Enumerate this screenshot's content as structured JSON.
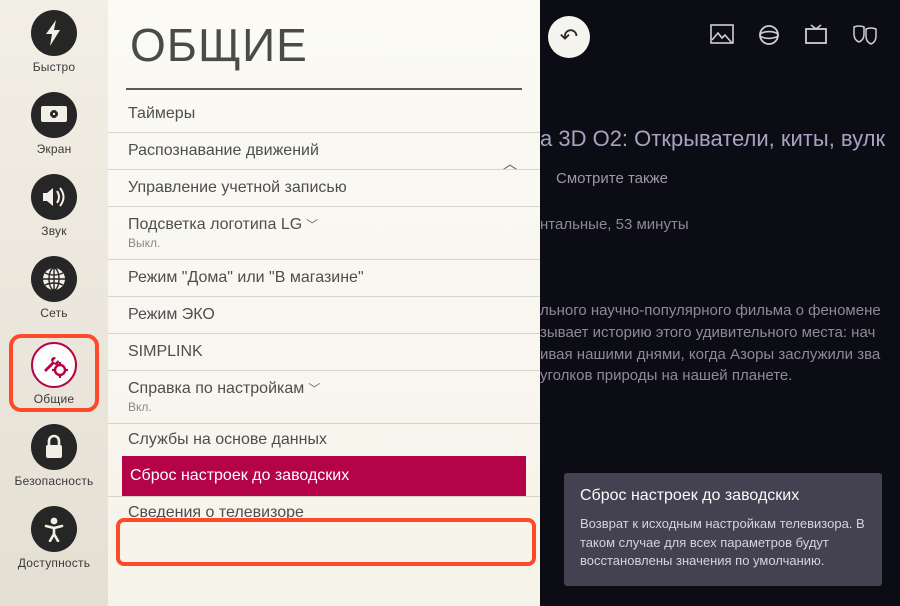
{
  "sidebar": {
    "items": [
      {
        "id": "quick",
        "label": "Быстро",
        "icon": "bolt"
      },
      {
        "id": "picture",
        "label": "Экран",
        "icon": "display"
      },
      {
        "id": "sound",
        "label": "Звук",
        "icon": "speaker"
      },
      {
        "id": "network",
        "label": "Сеть",
        "icon": "globe"
      },
      {
        "id": "general",
        "label": "Общие",
        "icon": "gear-wrench",
        "selected": true
      },
      {
        "id": "safety",
        "label": "Безопасность",
        "icon": "lock"
      },
      {
        "id": "accessibility",
        "label": "Доступность",
        "icon": "person"
      }
    ]
  },
  "panel": {
    "title": "ОБЩИЕ",
    "items": [
      {
        "label": "Таймеры"
      },
      {
        "label": "Распознавание движений"
      },
      {
        "label": "Управление учетной записью"
      },
      {
        "label": "Подсветка логотипа LG",
        "sub": "Выкл.",
        "chevron": true
      },
      {
        "label": "Режим \"Дома\" или \"В магазине\""
      },
      {
        "label": "Режим ЭКО"
      },
      {
        "label": "SIMPLINK"
      },
      {
        "label": "Справка по настройкам",
        "sub": "Вкл.",
        "chevron": true
      },
      {
        "label": "Службы на основе данных"
      },
      {
        "label": "Сброс настроек до заводских",
        "highlight": true
      },
      {
        "label": "Сведения о телевизоре"
      }
    ]
  },
  "background": {
    "title_fragment": "а 3D О2: Открыватели, киты, вулк",
    "see_also": "Смотрите также",
    "meta_fragment": "нтальные, 53 минуты",
    "description_fragment": "льного научно-популярного фильма о феномене\nзывает историю этого удивительного места: нач\nивая нашими днями, когда Азоры заслужили зва\nуголков природы на нашей планете."
  },
  "tooltip": {
    "title": "Сброс настроек до заводских",
    "body": "Возврат к исходным настройкам телевизора. В таком случае для всех параметров будут восстановлены значения по умолчанию."
  },
  "topicons": [
    "photo",
    "globe-ring",
    "tv",
    "masks"
  ]
}
